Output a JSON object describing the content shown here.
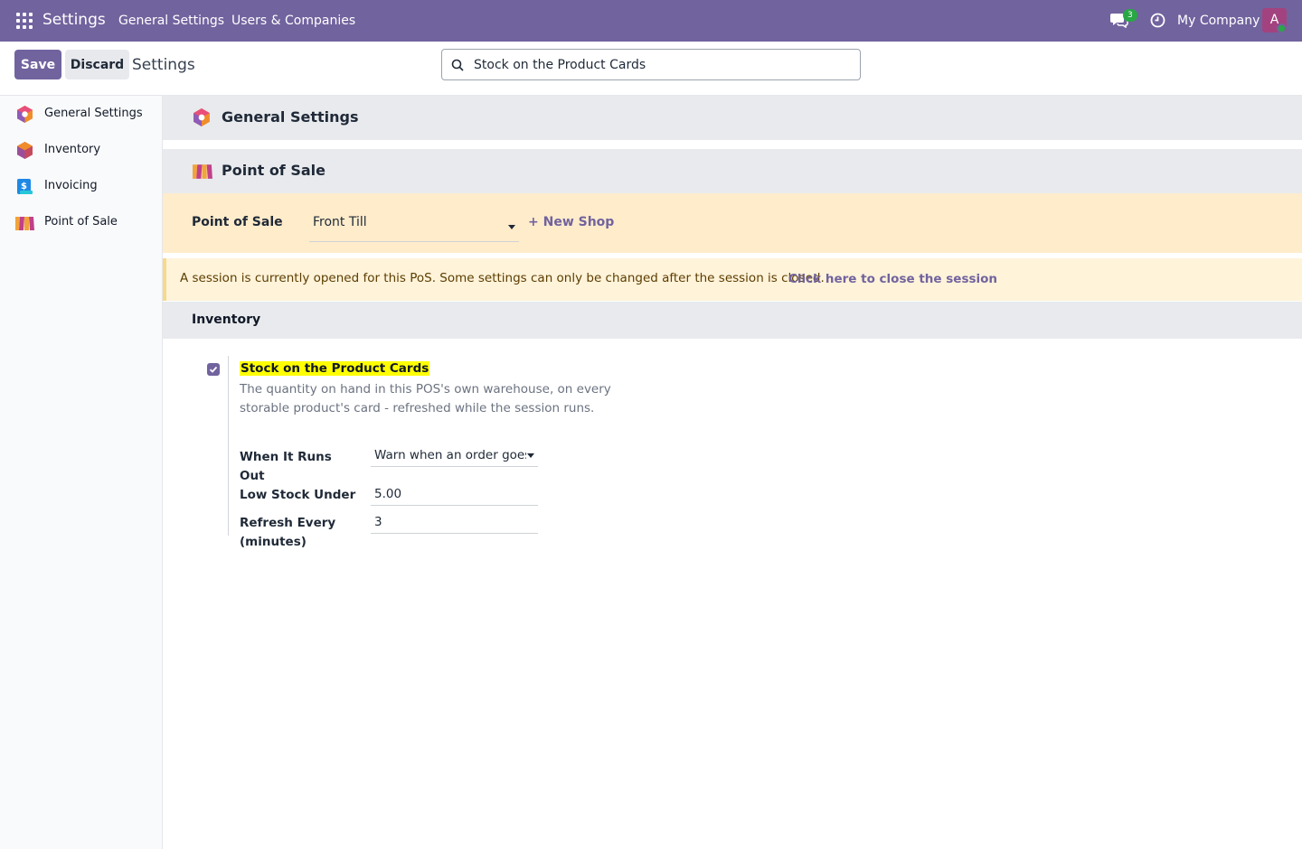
{
  "navbar": {
    "app_name": "Settings",
    "menu": [
      "General Settings",
      "Users & Companies"
    ],
    "chat_count": "3",
    "company": "My Company",
    "avatar_initial": "A",
    "brand_color": "#71639e"
  },
  "control_panel": {
    "save_label": "Save",
    "discard_label": "Discard",
    "title": "Settings",
    "search_value": "Stock on the Product Cards"
  },
  "sidebar": {
    "items": [
      {
        "label": "General Settings",
        "icon": "settings-hexagon-icon"
      },
      {
        "label": "Inventory",
        "icon": "inventory-cube-icon"
      },
      {
        "label": "Invoicing",
        "icon": "invoicing-icon"
      },
      {
        "label": "Point of Sale",
        "icon": "point-of-sale-icon"
      }
    ]
  },
  "main": {
    "general_settings_header": "General Settings",
    "pos_header": "Point of Sale",
    "pos_field_label": "Point of Sale",
    "pos_selected": "Front Till",
    "new_shop_label": "+ New Shop",
    "session_alert_text": "A session is currently opened for this PoS. Some settings can only be changed after the session is closed.",
    "session_alert_link": "Click here to close the session",
    "inventory_header": "Inventory",
    "setting": {
      "checked": true,
      "title": "Stock on the Product Cards",
      "description": "The quantity on hand in this POS's own warehouse, on every storable product's card - refreshed while the session runs.",
      "fields": [
        {
          "label": "When It Runs Out",
          "value": "Warn when an order goes below zero"
        },
        {
          "label": "Low Stock Under",
          "value": "5.00"
        },
        {
          "label": "Refresh Every (minutes)",
          "value": "3"
        }
      ]
    }
  }
}
